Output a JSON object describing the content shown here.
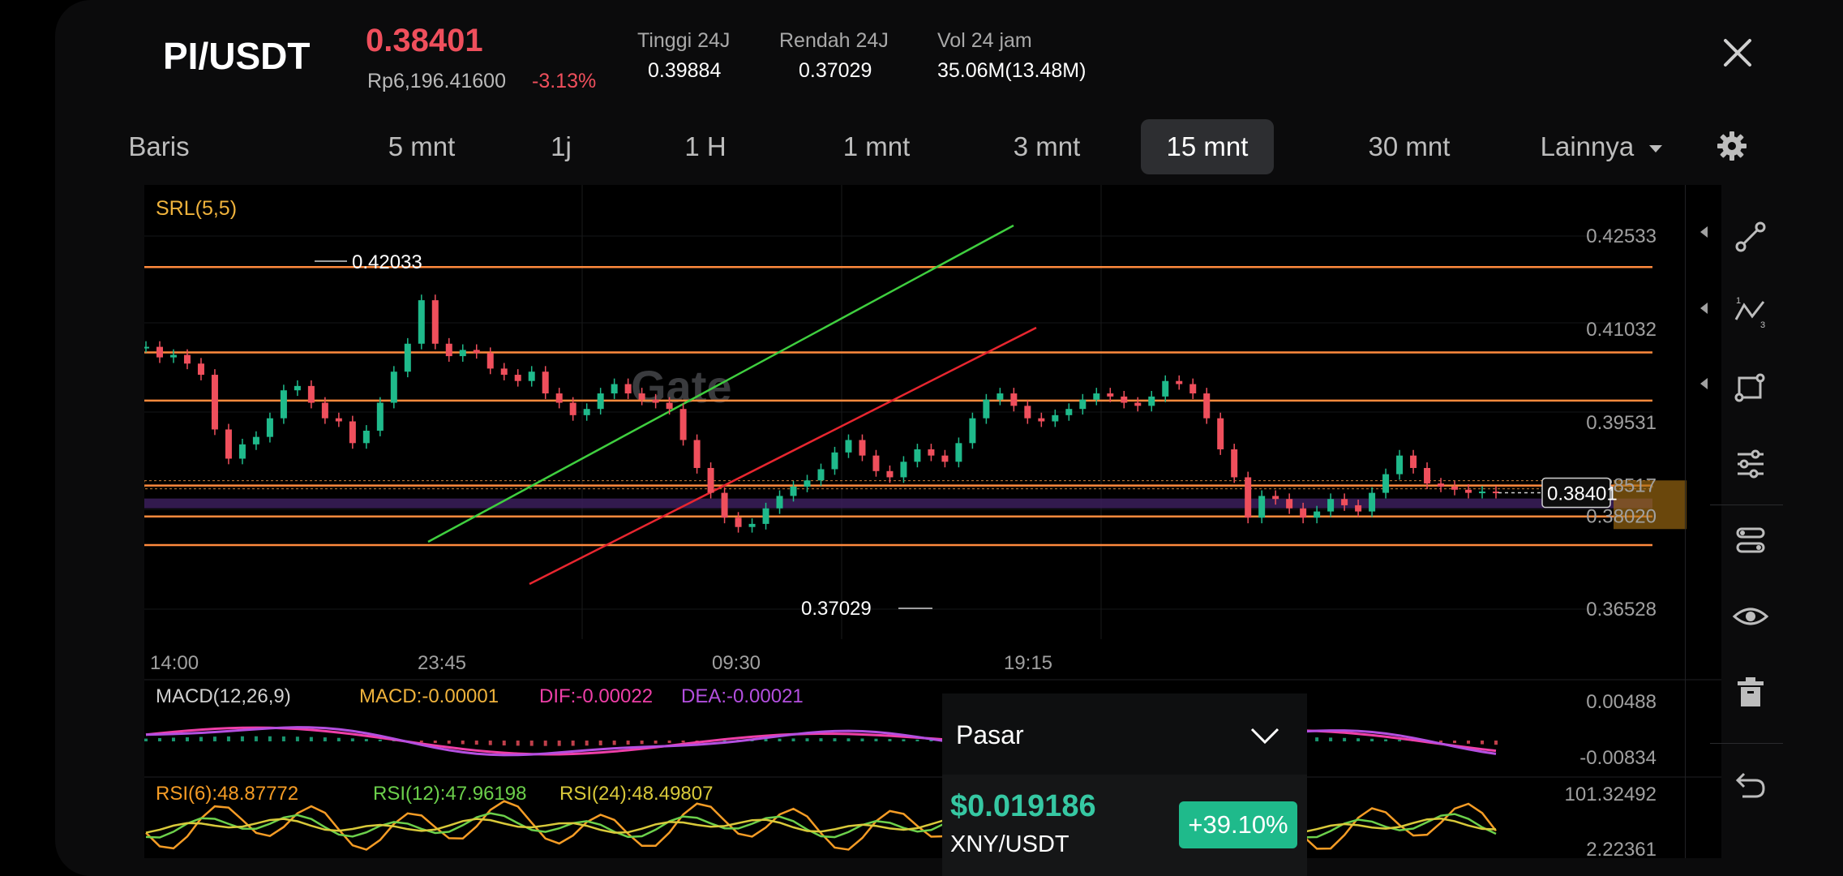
{
  "header": {
    "pair": "PI/USDT",
    "price": "0.38401",
    "price_idr": "Rp6,196.41600",
    "change": "-3.13%",
    "stats": [
      {
        "label": "Tinggi 24J",
        "value": "0.39884"
      },
      {
        "label": "Rendah 24J",
        "value": "0.37029"
      },
      {
        "label": "Vol 24 jam",
        "value": "35.06M(13.48M)"
      }
    ]
  },
  "tabs": [
    "Baris",
    "5 mnt",
    "1j",
    "1 H",
    "1 mnt",
    "3 mnt",
    "15 mnt",
    "30 mnt",
    "Lainnya"
  ],
  "active_tab": "15 mnt",
  "watermark": "Gate",
  "colors": {
    "up": "#1fba8b",
    "down": "#ef4f5c",
    "srl": "#ff8a3d",
    "up_channel": "#3fcf3f",
    "down_channel": "#e8262f",
    "macd_dif": "#ef3fa8",
    "macd_dea": "#b44fe0",
    "rsi6": "#f59c25",
    "rsi12": "#6cd04b",
    "rsi24": "#d9c93a"
  },
  "chart_data": {
    "type": "candlestick",
    "indicator_label": "SRL(5,5)",
    "y_ticks": [
      "0.42533",
      "0.41032",
      "0.39531",
      "0.38517",
      "0.38020",
      "0.36528"
    ],
    "x_ticks": [
      "14:00",
      "23:45",
      "09:30",
      "19:15"
    ],
    "last_price_tag": "0.38401",
    "high_marker": "0.42033",
    "low_marker": "0.37029",
    "srl_levels": [
      0.42033,
      0.4066,
      0.39884,
      0.38517,
      0.3802,
      0.3756
    ],
    "close_series": [
      0.4075,
      0.4058,
      0.4062,
      0.4048,
      0.403,
      0.3942,
      0.3895,
      0.3918,
      0.393,
      0.396,
      0.4005,
      0.4012,
      0.3985,
      0.396,
      0.3955,
      0.392,
      0.394,
      0.3985,
      0.4035,
      0.408,
      0.415,
      0.408,
      0.406,
      0.407,
      0.4065,
      0.404,
      0.403,
      0.402,
      0.4035,
      0.4,
      0.3985,
      0.3965,
      0.3975,
      0.4,
      0.4015,
      0.4,
      0.399,
      0.3985,
      0.3975,
      0.3925,
      0.388,
      0.384,
      0.38,
      0.3785,
      0.379,
      0.3815,
      0.3835,
      0.385,
      0.386,
      0.3878,
      0.3905,
      0.3925,
      0.39,
      0.3875,
      0.3865,
      0.389,
      0.391,
      0.39,
      0.389,
      0.392,
      0.396,
      0.399,
      0.4,
      0.398,
      0.396,
      0.3955,
      0.3965,
      0.3975,
      0.399,
      0.4,
      0.3995,
      0.3985,
      0.398,
      0.3995,
      0.402,
      0.4015,
      0.4,
      0.396,
      0.391,
      0.3865,
      0.38,
      0.3835,
      0.383,
      0.3815,
      0.38,
      0.381,
      0.383,
      0.382,
      0.381,
      0.384,
      0.387,
      0.39,
      0.388,
      0.3855,
      0.385,
      0.3845,
      0.384,
      0.3842,
      0.384
    ],
    "macd": {
      "label": "MACD(12,26,9)",
      "macd_label": "MACD:-0.00001",
      "dif_label": "DIF:-0.00022",
      "dea_label": "DEA:-0.00021",
      "y_ticks": [
        "0.00488",
        "-0.00834"
      ]
    },
    "rsi": {
      "rsi6_label": "RSI(6):48.87772",
      "rsi12_label": "RSI(12):47.96198",
      "rsi24_label": "RSI(24):48.49807",
      "y_ticks": [
        "101.32492",
        "2.22361"
      ]
    }
  },
  "popup": {
    "title": "Pasar",
    "price": "$0.019186",
    "pair": "XNY/USDT",
    "change": "+39.10%"
  }
}
